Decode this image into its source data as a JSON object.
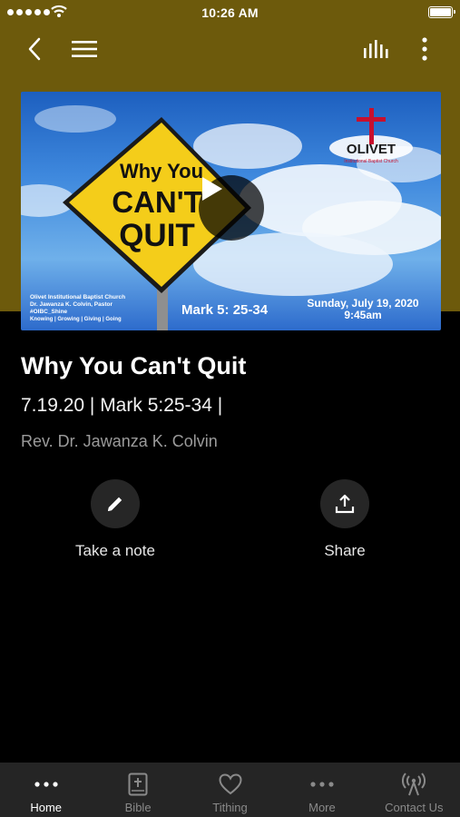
{
  "status_bar": {
    "time": "10:26 AM"
  },
  "nav": {
    "back_icon": "chevron-left-icon",
    "menu_icon": "hamburger-menu-icon",
    "audio_icon": "audio-levels-icon",
    "more_icon": "vertical-dots-icon"
  },
  "media": {
    "sign_line1": "Why You",
    "sign_line2": "CAN'T",
    "sign_line3": "QUIT",
    "church_logo_text": "OLIVET",
    "church_logo_sub": "Institutional Baptist Church",
    "church_info": [
      "Olivet Institutional Baptist Church",
      "Dr. Jawanza K. Colvin, Pastor",
      "#OIBC_Shine",
      "Knowing | Growing | Giving | Going"
    ],
    "scripture": "Mark 5: 25-34",
    "date_line1": "Sunday, July 19, 2020",
    "date_line2": "9:45am"
  },
  "sermon": {
    "title": "Why You Can't Quit",
    "subtitle": "7.19.20 | Mark 5:25-34 |",
    "speaker": "Rev. Dr. Jawanza K. Colvin"
  },
  "actions": {
    "note_label": "Take a note",
    "share_label": "Share"
  },
  "tabs": [
    {
      "label": "Home",
      "icon": "dots-icon",
      "active": true
    },
    {
      "label": "Bible",
      "icon": "bible-icon",
      "active": false
    },
    {
      "label": "Tithing",
      "icon": "heart-icon",
      "active": false
    },
    {
      "label": "More",
      "icon": "dots-icon",
      "active": false
    },
    {
      "label": "Contact Us",
      "icon": "broadcast-icon",
      "active": false
    }
  ],
  "colors": {
    "header_band": "#6d5a0c",
    "background": "#000000",
    "tab_bar": "#252525",
    "sign_yellow": "#f4cd1a"
  }
}
